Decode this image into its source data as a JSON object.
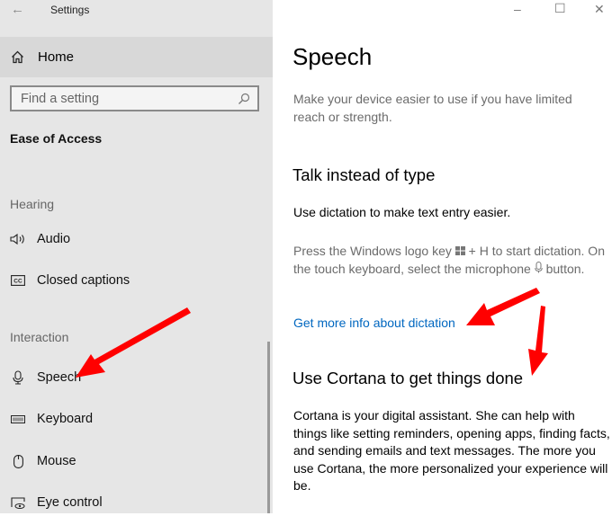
{
  "window": {
    "title": "Settings",
    "back_icon": "arrow-left-icon",
    "minimize": "–",
    "maximize": "☐",
    "close": "✕"
  },
  "sidebar": {
    "home": "Home",
    "search_placeholder": "Find a setting",
    "category": "Ease of Access",
    "groups": [
      {
        "label": "Hearing",
        "items": [
          {
            "label": "Audio",
            "icon": "speaker-icon"
          },
          {
            "label": "Closed captions",
            "icon": "cc-icon"
          }
        ]
      },
      {
        "label": "Interaction",
        "items": [
          {
            "label": "Speech",
            "icon": "microphone-icon"
          },
          {
            "label": "Keyboard",
            "icon": "keyboard-icon"
          },
          {
            "label": "Mouse",
            "icon": "mouse-icon"
          },
          {
            "label": "Eye control",
            "icon": "eye-control-icon"
          }
        ]
      }
    ]
  },
  "main": {
    "title": "Speech",
    "intro": "Make your device easier to use if you have limited reach or strength.",
    "section1": {
      "heading": "Talk instead of type",
      "text": "Use dictation to make text entry easier.",
      "hint_a": "Press the Windows logo key ",
      "hint_b": " + H to start dictation. On the touch keyboard, select the microphone ",
      "hint_c": " button.",
      "link": "Get more info about dictation"
    },
    "section2": {
      "heading": "Use Cortana to get things done",
      "text": "Cortana is your digital assistant.  She can help with things like setting reminders, opening apps, finding facts, and sending emails and text messages.  The more you use Cortana, the more personalized your experience will be."
    }
  },
  "annotations": {
    "arrow_color": "#ff0000"
  }
}
